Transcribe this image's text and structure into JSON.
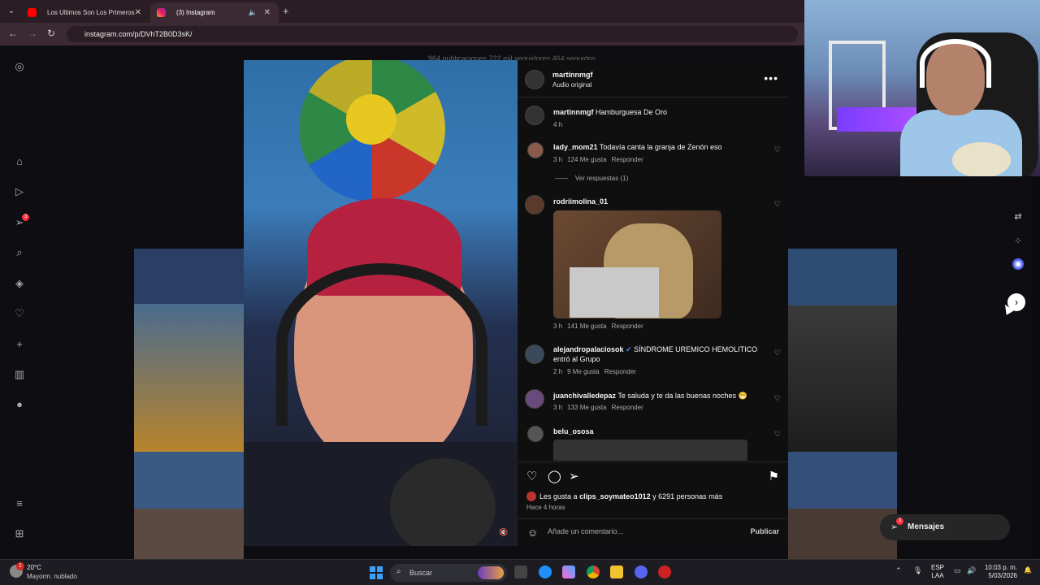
{
  "browser": {
    "tabs": [
      {
        "label": "Los Ultimos Son Los Primeros ·"
      },
      {
        "label": "(3) Instagram"
      }
    ],
    "url": "instagram.com/p/DVhT2B0D3sK/"
  },
  "profile_stats": "964 publicaciones   722 mil seguidores   464 seguidos",
  "sidebar": {
    "notification_count": "3",
    "icons": [
      "instagram-icon",
      "home-icon",
      "reels-icon",
      "messages-icon",
      "search-icon",
      "explore-icon",
      "heart-icon",
      "create-icon",
      "dashboard-icon",
      "threads-icon",
      "menu-icon",
      "more-icon"
    ]
  },
  "post": {
    "username": "martinnmgf",
    "audio": "Audio original",
    "caption_user": "martinnmgf",
    "caption_text": "Hamburguesa De Oro",
    "caption_time": "4 h",
    "comments": [
      {
        "user": "lady_mom21",
        "text": "Todavía canta la granja de Zenón eso",
        "time": "3 h",
        "likes": "124 Me gusta",
        "reply": "Responder",
        "view_replies": "Ver respuestas (1)"
      },
      {
        "user": "rodriimolina_01",
        "text": "",
        "time": "3 h",
        "likes": "141 Me gusta",
        "reply": "Responder"
      },
      {
        "user": "alejandropalaciosok",
        "text": "SÍNDROME UREMICO HEMOLITICO entró al Grupo",
        "time": "2 h",
        "likes": "9 Me gusta",
        "reply": "Responder"
      },
      {
        "user": "juanchivalledepaz",
        "text": "Te saluda y te da las buenas noches 😁",
        "time": "3 h",
        "likes": "133 Me gusta",
        "reply": "Responder"
      },
      {
        "user": "belu_ososa",
        "text": ""
      }
    ],
    "likes_prefix": "Les gusta a",
    "likes_user": "clips_soymateo1012",
    "likes_suffix": "y 6291 personas más",
    "posted_ago": "Hace 4 horas",
    "comment_placeholder": "Añade un comentario...",
    "publish_label": "Publicar"
  },
  "messages_pill": {
    "label": "Mensajes",
    "count": "3"
  },
  "taskbar": {
    "weather_temp": "20°C",
    "weather_desc": "Mayorm. nublado",
    "weather_badge": "1",
    "search_label": "Buscar",
    "lang_line1": "ESP",
    "lang_line2": "LAA",
    "time": "10:03 p. m.",
    "date": "5/03/2026"
  },
  "colors": {
    "accent": "#ff3040",
    "panel": "#0f0f0f",
    "tab_bar": "#2a1d24"
  }
}
